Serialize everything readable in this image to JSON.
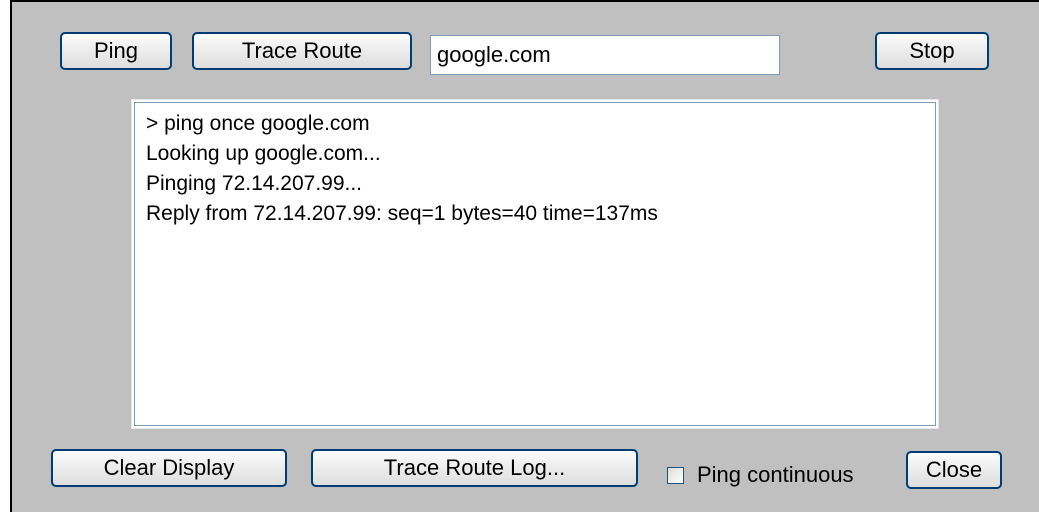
{
  "toolbar": {
    "ping_label": "Ping",
    "trace_route_label": "Trace Route",
    "host_value": "google.com",
    "stop_label": "Stop"
  },
  "output": {
    "lines": [
      "> ping once google.com",
      "Looking up google.com...",
      "Pinging 72.14.207.99...",
      "Reply from 72.14.207.99: seq=1 bytes=40 time=137ms"
    ]
  },
  "footer": {
    "clear_display_label": "Clear Display",
    "trace_route_log_label": "Trace Route Log...",
    "ping_continuous_label": "Ping continuous",
    "ping_continuous_checked": false,
    "close_label": "Close"
  }
}
